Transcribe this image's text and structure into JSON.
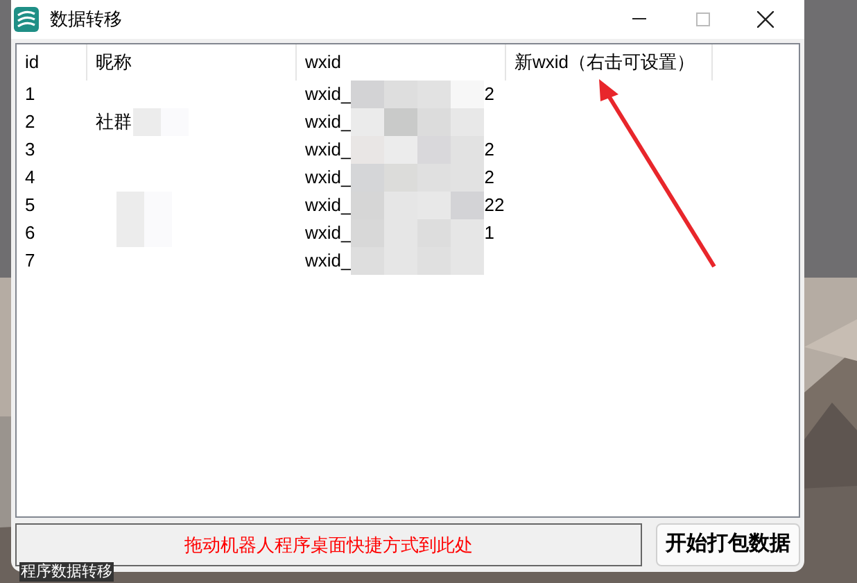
{
  "window": {
    "title": "数据转移"
  },
  "table": {
    "columns": [
      "id",
      "昵称",
      "wxid",
      "新wxid（右击可设置）"
    ],
    "rows": [
      {
        "id": "1",
        "nickname": "",
        "nickname_blurred": false,
        "wxid": "wxid_",
        "wxid_tail": "2"
      },
      {
        "id": "2",
        "nickname": "社群",
        "nickname_blurred": true,
        "wxid": "wxid_",
        "wxid_tail": ""
      },
      {
        "id": "3",
        "nickname": "",
        "nickname_blurred": false,
        "wxid": "wxid_",
        "wxid_tail": "2"
      },
      {
        "id": "4",
        "nickname": "",
        "nickname_blurred": false,
        "wxid": "wxid_",
        "wxid_tail": "2"
      },
      {
        "id": "5",
        "nickname": "",
        "nickname_blurred": true,
        "wxid": "wxid_",
        "wxid_tail": "22"
      },
      {
        "id": "6",
        "nickname": "",
        "nickname_blurred": true,
        "wxid": "wxid_",
        "wxid_tail": "1"
      },
      {
        "id": "7",
        "nickname": "",
        "nickname_blurred": false,
        "wxid": "wxid_",
        "wxid_tail": ""
      }
    ]
  },
  "drop_area": {
    "label": "拖动机器人程序桌面快捷方式到此处"
  },
  "start_button": {
    "label": "开始打包数据"
  },
  "desktop_label": "程序数据转移"
}
